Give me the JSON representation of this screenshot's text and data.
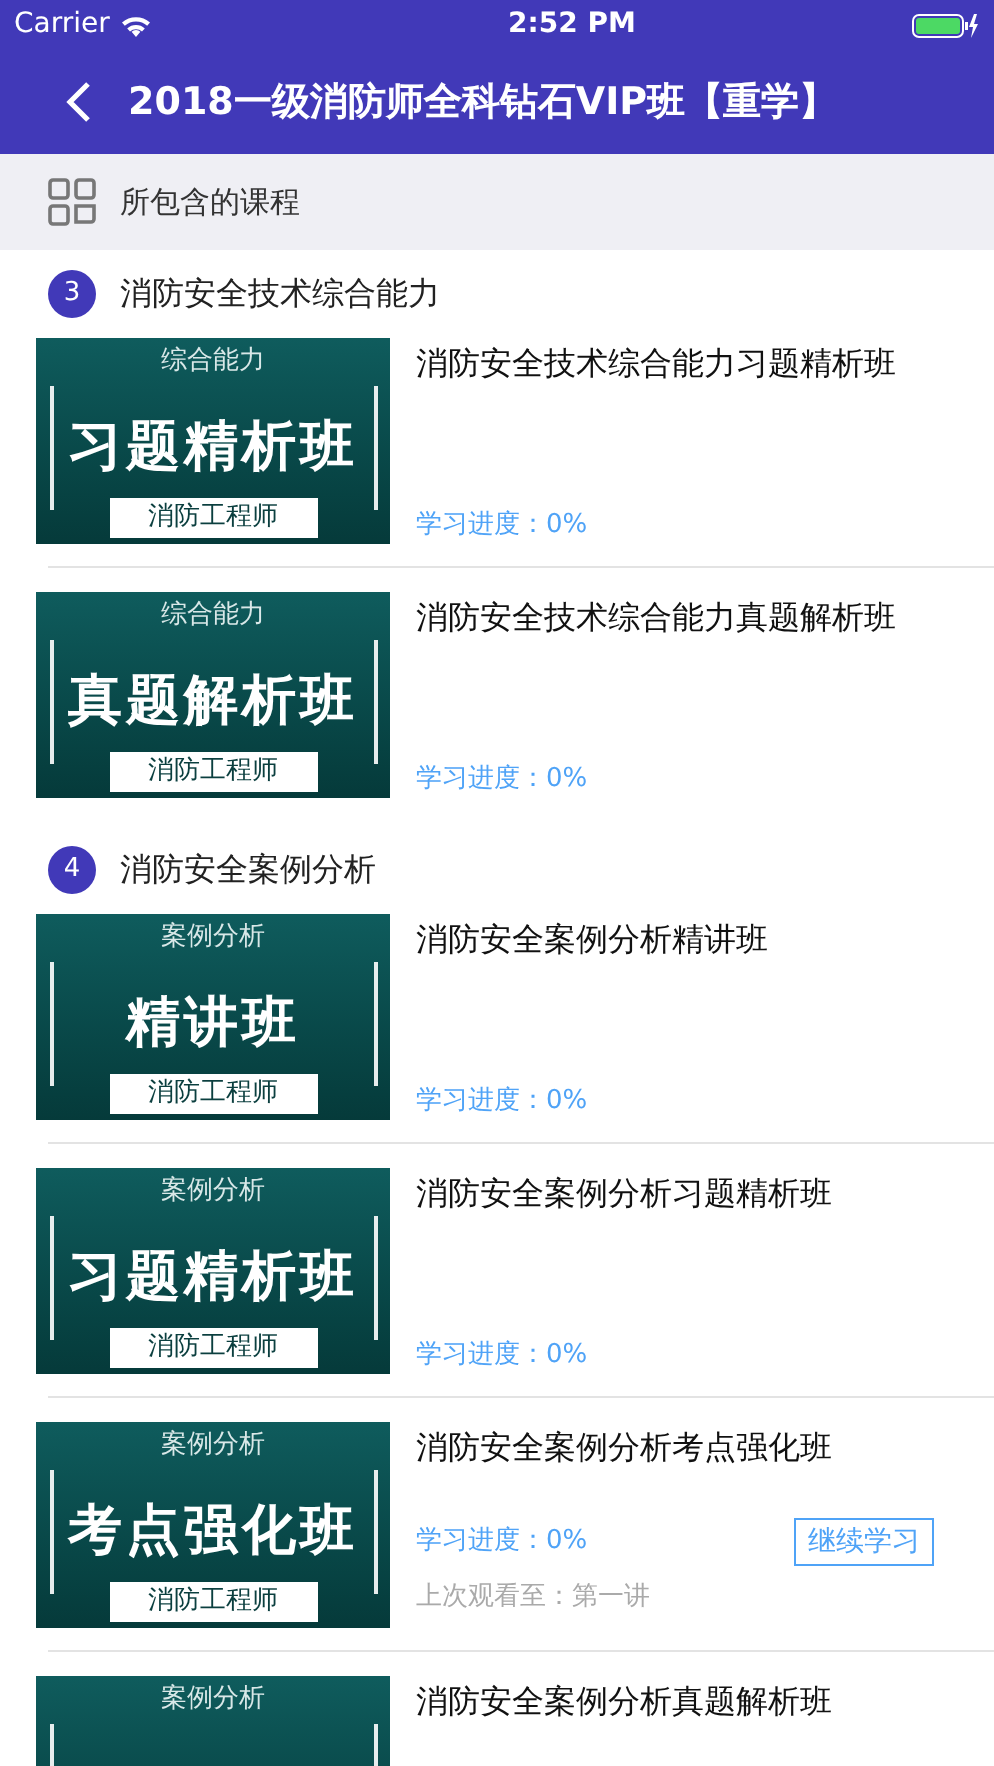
{
  "status_bar": {
    "carrier": "Carrier",
    "time": "2:52 PM"
  },
  "nav": {
    "title": "2018一级消防师全科钻石VIP班【重学】"
  },
  "subheader": {
    "label": "所包含的课程"
  },
  "sections": [
    {
      "number": "3",
      "title": "消防安全技术综合能力",
      "courses": [
        {
          "category": "综合能力",
          "banner": "习题精析班",
          "tag": "消防工程师",
          "title": "消防安全技术综合能力习题精析班",
          "progress": "学习进度：0%"
        },
        {
          "category": "综合能力",
          "banner": "真题解析班",
          "tag": "消防工程师",
          "title": "消防安全技术综合能力真题解析班",
          "progress": "学习进度：0%"
        }
      ]
    },
    {
      "number": "4",
      "title": "消防安全案例分析",
      "courses": [
        {
          "category": "案例分析",
          "banner": "精讲班",
          "tag": "消防工程师",
          "title": "消防安全案例分析精讲班",
          "progress": "学习进度：0%"
        },
        {
          "category": "案例分析",
          "banner": "习题精析班",
          "tag": "消防工程师",
          "title": "消防安全案例分析习题精析班",
          "progress": "学习进度：0%"
        },
        {
          "category": "案例分析",
          "banner": "考点强化班",
          "tag": "消防工程师",
          "title": "消防安全案例分析考点强化班",
          "progress": "学习进度：0%",
          "button": "继续学习",
          "last_watched": "上次观看至：第一讲"
        },
        {
          "category": "案例分析",
          "title": "消防安全案例分析真题解析班"
        }
      ]
    }
  ]
}
